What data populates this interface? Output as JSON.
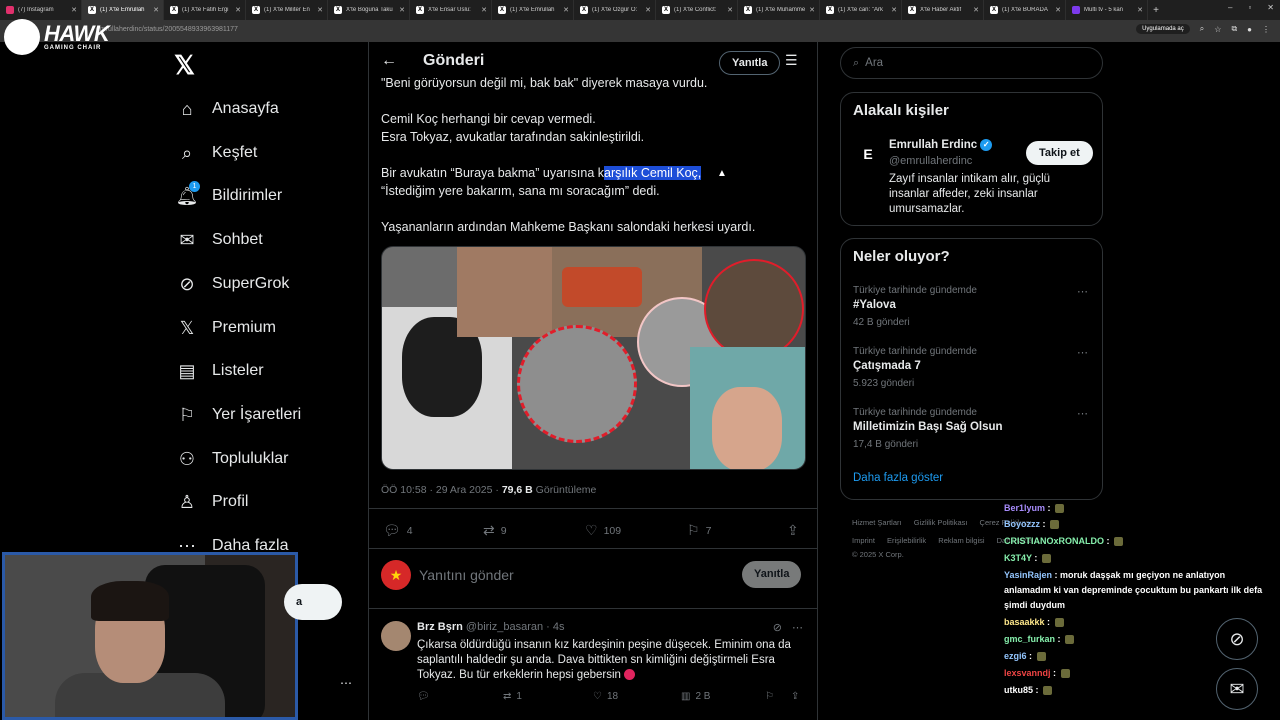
{
  "browser": {
    "tabs": [
      {
        "label": "(7) Instagram",
        "active": false
      },
      {
        "label": "(1) X'te Emrullah",
        "active": true
      },
      {
        "label": "(1) X'te Fatih Ergi",
        "active": false
      },
      {
        "label": "(1) X'te Militer En",
        "active": false
      },
      {
        "label": "X'te Boguna Taku",
        "active": false
      },
      {
        "label": "X'te Ensar Uslu:",
        "active": false
      },
      {
        "label": "(1) X'te Emrullah",
        "active": false
      },
      {
        "label": "(1) X'te Özgür Ö:",
        "active": false
      },
      {
        "label": "(1) X'te Conflict:",
        "active": false
      },
      {
        "label": "(1) X'te Muhamme",
        "active": false
      },
      {
        "label": "(1) X'te can: \"Ark",
        "active": false
      },
      {
        "label": "X'te Haber Aktif",
        "active": false
      },
      {
        "label": "(1) X'te BURADA",
        "active": false
      },
      {
        "label": "Multi tv - 5 kan",
        "active": false
      }
    ],
    "url": "emrullaherdinc/status/2005548933963981177",
    "app_pill": "Uygulamada aç"
  },
  "overlay_logo": {
    "line1": "HAWK",
    "line2": "GAMING CHAIR"
  },
  "nav": {
    "items": [
      {
        "label": "Anasayfa",
        "icon": "home-icon"
      },
      {
        "label": "Keşfet",
        "icon": "search-icon"
      },
      {
        "label": "Bildirimler",
        "icon": "bell-icon",
        "badge": "1"
      },
      {
        "label": "Sohbet",
        "icon": "mail-icon"
      },
      {
        "label": "SuperGrok",
        "icon": "grok-icon"
      },
      {
        "label": "Premium",
        "icon": "x-icon"
      },
      {
        "label": "Listeler",
        "icon": "list-icon"
      },
      {
        "label": "Yer İşaretleri",
        "icon": "bookmark-icon"
      },
      {
        "label": "Topluluklar",
        "icon": "community-icon"
      },
      {
        "label": "Profil",
        "icon": "profile-icon"
      },
      {
        "label": "Daha fazla",
        "icon": "more-icon"
      }
    ]
  },
  "main": {
    "title": "Gönderi",
    "reply_button": "Yanıtla",
    "tweet": {
      "line0": "\"Beni görüyorsun değil mi, bak bak\" diyerek masaya vurdu.",
      "line1": "Cemil Koç herhangi bir cevap vermedi.",
      "line2": "Esra Tokyaz, avukatlar tarafından sakinleştirildi.",
      "line3_pre": "Bir avukatın “Buraya bakma” uyarısına k",
      "line3_hl": "arşılık Cemil Koç,",
      "line4": "“İstediğim yere bakarım, sana mı soracağım” dedi.",
      "line5": "Yaşananların ardından Mahkeme Başkanı salondaki herkesi uyardı."
    },
    "meta": {
      "time": "ÖÖ 10:58 · 29 Ara 2025 · ",
      "views": "79,6 B",
      "views_label": " Görüntüleme"
    },
    "actions": {
      "replies": "4",
      "reposts": "9",
      "likes": "109",
      "bookmarks": "7"
    },
    "composer": {
      "placeholder": "Yanıtını gönder",
      "button": "Yanıtla"
    },
    "reply": {
      "name": "Brz Bşrn",
      "handle": "@biriz_basaran · 4s",
      "line1": "Çıkarsa öldürdüğü insanın kız kardeşinin peşine düşecek. Eminim ona da",
      "line2": "saplantılı haldedir şu anda. Dava bittikten sn kimliğini değiştirmeli Esra",
      "line3": "Tokyaz. Bu tür erkeklerin hepsi gebersin",
      "reposts": "1",
      "likes": "18",
      "views": "2 B"
    }
  },
  "right": {
    "search_placeholder": "Ara",
    "related": {
      "title": "Alakalı kişiler",
      "name": "Emrullah Erdinc",
      "handle": "@emrullaherdinc",
      "follow": "Takip et",
      "bio1": "Zayıf insanlar intikam alır, güçlü",
      "bio2": "insanlar affeder, zeki insanlar",
      "bio3": "umursamazlar."
    },
    "trends": {
      "title": "Neler oluyor?",
      "items": [
        {
          "context": "Türkiye tarihinde gündemde",
          "title": "#Yalova",
          "count": "42 B gönderi"
        },
        {
          "context": "Türkiye tarihinde gündemde",
          "title": "Çatışmada 7",
          "count": "5.923 gönderi"
        },
        {
          "context": "Türkiye tarihinde gündemde",
          "title": "Milletimizin Başı Sağ Olsun",
          "count": "17,4 B gönderi"
        }
      ],
      "show_more": "Daha fazla göster"
    },
    "footer": {
      "row1": [
        "Hizmet Şartları",
        "Gizlilik Politikası",
        "Çerez Politikası"
      ],
      "row2": [
        "Imprint",
        "Erişilebilirlik",
        "Reklam bilgisi",
        "Daha fazla ..."
      ],
      "copyright": "© 2025 X Corp."
    }
  },
  "chat": [
    {
      "user": "Ber1lyum",
      "color": "#a78bfa",
      "msg": ""
    },
    {
      "user": "Boyozzz",
      "color": "#93c5fd",
      "msg": ""
    },
    {
      "user": "CRISTIANOxRONALDO",
      "color": "#86efac",
      "msg": ""
    },
    {
      "user": "K3T4Y",
      "color": "#86efac",
      "msg": ""
    },
    {
      "user": "YasinRajen",
      "color": "#93c5fd",
      "msg": "moruk daşşak mı geçiyon ne anlatıyon"
    },
    {
      "user": "",
      "color": "#ffffff",
      "msg": "anlamadım ki van depreminde çocuktum bu pankartı ilk defa"
    },
    {
      "user": "",
      "color": "#ffffff",
      "msg": "şimdi duydum"
    },
    {
      "user": "basaakkk",
      "color": "#fde68a",
      "msg": ""
    },
    {
      "user": "gmc_furkan",
      "color": "#86efac",
      "msg": ""
    },
    {
      "user": "ezgi6",
      "color": "#93c5fd",
      "msg": ""
    },
    {
      "user": "lexsvanndj",
      "color": "#ef4444",
      "msg": ""
    },
    {
      "user": "utku85",
      "color": "#ffffff",
      "msg": ""
    }
  ],
  "webcam": {
    "partial_label": "a"
  },
  "colors": {
    "accent": "#1d9bf0",
    "background": "#000000",
    "border": "#2f3336",
    "muted": "#71767b",
    "highlight": "#1d4ed8"
  }
}
